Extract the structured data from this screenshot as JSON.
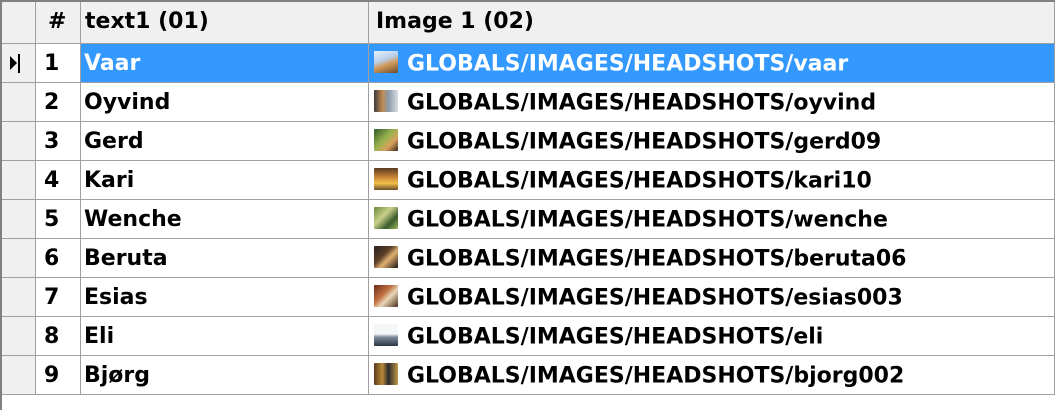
{
  "header": {
    "num": "#",
    "col1": "text1 (01)",
    "col2": "Image 1 (02)"
  },
  "rows": [
    {
      "num": "1",
      "text": "Vaar",
      "image": "GLOBALS/IMAGES/HEADSHOTS/vaar",
      "thumb": "headshot-thumbnail"
    },
    {
      "num": "2",
      "text": "Oyvind",
      "image": "GLOBALS/IMAGES/HEADSHOTS/oyvind",
      "thumb": "headshot-thumbnail"
    },
    {
      "num": "3",
      "text": "Gerd",
      "image": "GLOBALS/IMAGES/HEADSHOTS/gerd09",
      "thumb": "headshot-thumbnail"
    },
    {
      "num": "4",
      "text": "Kari",
      "image": "GLOBALS/IMAGES/HEADSHOTS/kari10",
      "thumb": "headshot-thumbnail"
    },
    {
      "num": "5",
      "text": "Wenche",
      "image": "GLOBALS/IMAGES/HEADSHOTS/wenche",
      "thumb": "headshot-thumbnail"
    },
    {
      "num": "6",
      "text": "Beruta",
      "image": "GLOBALS/IMAGES/HEADSHOTS/beruta06",
      "thumb": "headshot-thumbnail"
    },
    {
      "num": "7",
      "text": "Esias",
      "image": "GLOBALS/IMAGES/HEADSHOTS/esias003",
      "thumb": "headshot-thumbnail"
    },
    {
      "num": "8",
      "text": "Eli",
      "image": "GLOBALS/IMAGES/HEADSHOTS/eli",
      "thumb": "headshot-thumbnail"
    },
    {
      "num": "9",
      "text": "Bjørg",
      "image": "GLOBALS/IMAGES/HEADSHOTS/bjorg002",
      "thumb": "headshot-thumbnail"
    }
  ],
  "selected_row": "1",
  "colors": {
    "selection": "#3399ff",
    "header_bg": "#f0f0f0",
    "grid_line": "#a0a0a0"
  }
}
